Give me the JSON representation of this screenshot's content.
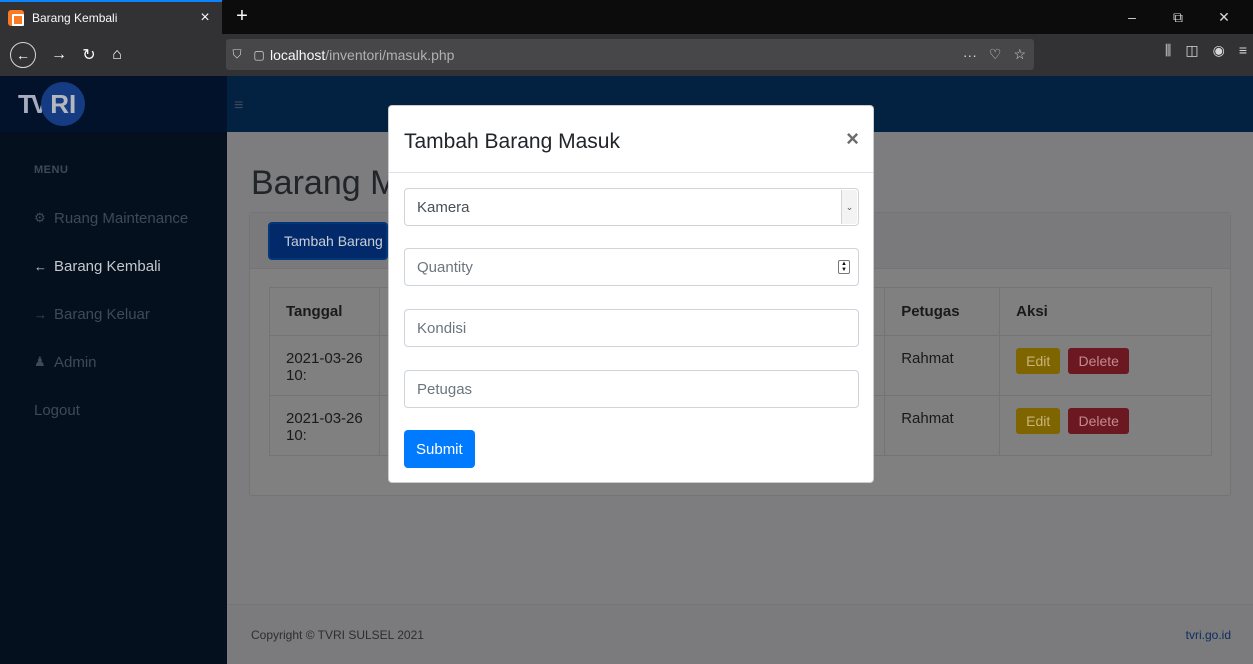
{
  "browser": {
    "tab_title": "Barang Kembali",
    "tab_close": "×",
    "new_tab": "+",
    "url_host": "localhost",
    "url_path": "/inventori/masuk.php",
    "page_actions": "···",
    "window_minimize": "–",
    "window_restore": "⧉",
    "window_close": "✕"
  },
  "brand": {
    "tv": "TV",
    "ri": "RI"
  },
  "sidebar": {
    "heading": "MENU",
    "items": [
      {
        "icon": "⚙",
        "label": "Ruang Maintenance",
        "active": false
      },
      {
        "icon": "←",
        "label": "Barang Kembali",
        "active": true
      },
      {
        "icon": "→",
        "label": "Barang Keluar",
        "active": false
      },
      {
        "icon": "♟",
        "label": "Admin",
        "active": false
      },
      {
        "icon": "",
        "label": "Logout",
        "active": false
      }
    ]
  },
  "main": {
    "title": "Barang Masuk",
    "add_button": "Tambah Barang Masuk",
    "table": {
      "headers": {
        "tanggal": "Tanggal",
        "petugas": "Petugas",
        "aksi": "Aksi"
      },
      "rows": [
        {
          "tanggal": "2021-03-26 10:",
          "petugas": "Rahmat"
        },
        {
          "tanggal": "2021-03-26 10:",
          "petugas": "Rahmat"
        }
      ],
      "edit_label": "Edit",
      "delete_label": "Delete"
    }
  },
  "footer": {
    "copyright": "Copyright © TVRI SULSEL 2021",
    "site": "tvri.go.id"
  },
  "modal": {
    "title": "Tambah Barang Masuk",
    "close": "×",
    "select_value": "Kamera",
    "quantity_placeholder": "Quantity",
    "kondisi_placeholder": "Kondisi",
    "petugas_placeholder": "Petugas",
    "submit": "Submit"
  }
}
